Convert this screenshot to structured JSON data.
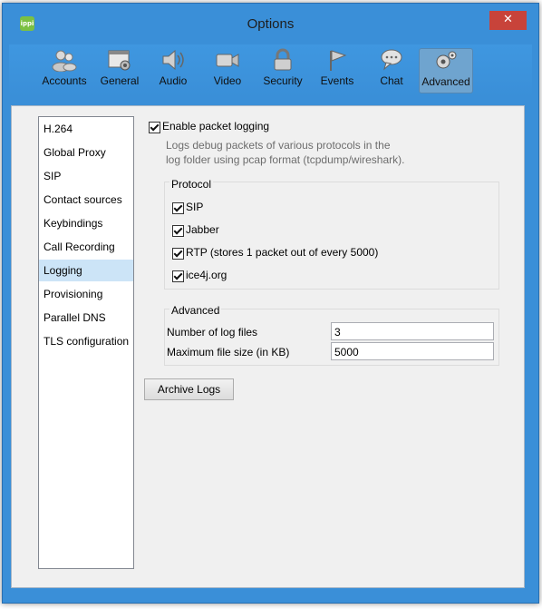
{
  "window": {
    "title": "Options",
    "app_icon_text": "ippi",
    "close_glyph": "✕"
  },
  "toolbar": {
    "items": [
      {
        "label": "Accounts",
        "icon": "accounts-icon"
      },
      {
        "label": "General",
        "icon": "general-icon"
      },
      {
        "label": "Audio",
        "icon": "audio-icon"
      },
      {
        "label": "Video",
        "icon": "video-icon"
      },
      {
        "label": "Security",
        "icon": "security-icon"
      },
      {
        "label": "Events",
        "icon": "events-icon"
      },
      {
        "label": "Chat",
        "icon": "chat-icon"
      },
      {
        "label": "Advanced",
        "icon": "advanced-icon",
        "selected": true
      }
    ]
  },
  "sidebar": {
    "items": [
      {
        "label": "H.264"
      },
      {
        "label": "Global Proxy"
      },
      {
        "label": "SIP"
      },
      {
        "label": "Contact sources"
      },
      {
        "label": "Keybindings"
      },
      {
        "label": "Call Recording"
      },
      {
        "label": "Logging",
        "selected": true
      },
      {
        "label": "Provisioning"
      },
      {
        "label": "Parallel DNS"
      },
      {
        "label": "TLS configuration"
      }
    ]
  },
  "logging": {
    "enable_label": "Enable packet logging",
    "enable_checked": true,
    "description_line1": "Logs debug packets of various protocols in the",
    "description_line2": "log folder using pcap format (tcpdump/wireshark).",
    "protocol_title": "Protocol",
    "protocols": [
      {
        "label": "SIP",
        "checked": true
      },
      {
        "label": "Jabber",
        "checked": true
      },
      {
        "label": "RTP (stores 1 packet out of every 5000)",
        "checked": true
      },
      {
        "label": "ice4j.org",
        "checked": true
      }
    ],
    "advanced_title": "Advanced",
    "num_files_label": "Number of log files",
    "num_files_value": "3",
    "max_size_label": "Maximum file size (in KB)",
    "max_size_value": "5000",
    "archive_button": "Archive Logs"
  },
  "colors": {
    "title_bar": "#3a8fd8",
    "close_button": "#c8433a",
    "selection": "#cce4f7"
  }
}
